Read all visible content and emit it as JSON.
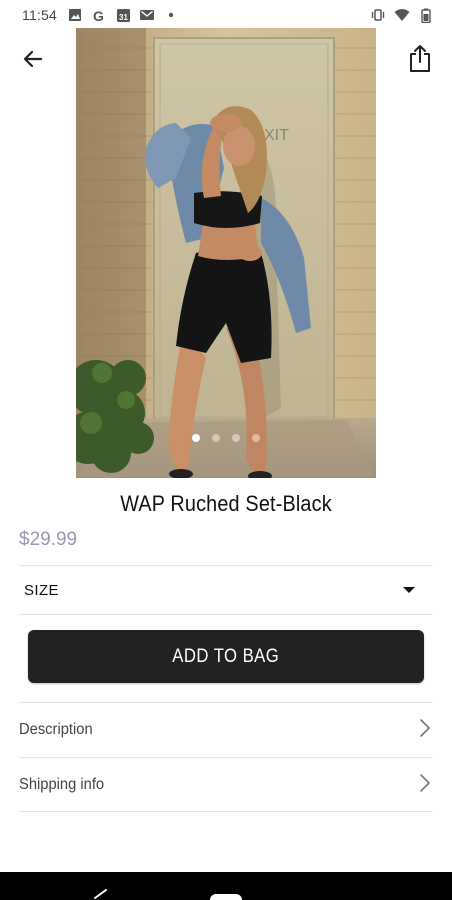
{
  "status_bar": {
    "time": "11:54",
    "notification_icons": [
      "image-icon",
      "google-icon",
      "calendar-icon",
      "gmail-icon",
      "dot-icon"
    ],
    "system_icons": [
      "vibrate-icon",
      "wifi-icon",
      "battery-icon"
    ]
  },
  "header": {
    "back_icon": "arrow-left-icon",
    "share_icon": "share-icon"
  },
  "carousel": {
    "total_images": 4,
    "active_index": 0
  },
  "product": {
    "title": "WAP Ruched Set-Black",
    "price": "$29.99",
    "price_color": "#9a97b3"
  },
  "size_selector": {
    "label": "SIZE"
  },
  "actions": {
    "add_to_bag_label": "ADD TO BAG",
    "button_color": "#222222"
  },
  "details": [
    {
      "label": "Description"
    },
    {
      "label": "Shipping info"
    }
  ]
}
